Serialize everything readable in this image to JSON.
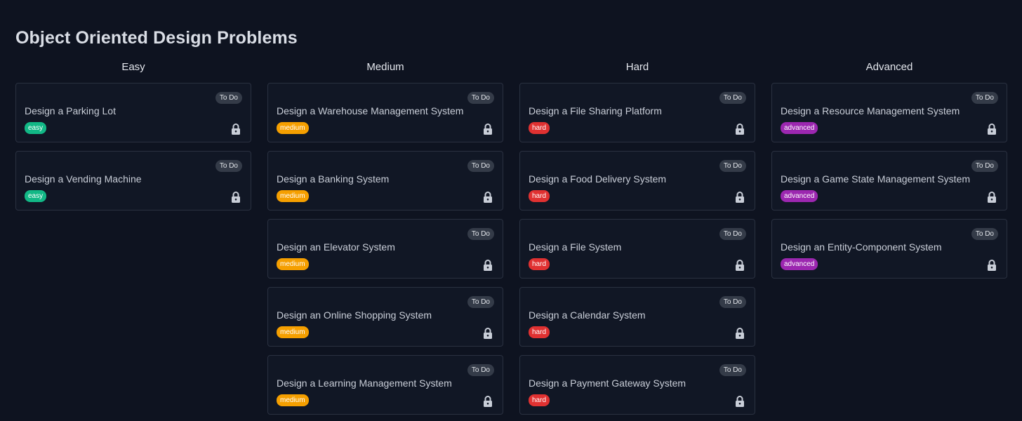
{
  "page": {
    "title": "Object Oriented Design Problems"
  },
  "columns": [
    {
      "title": "Easy",
      "level": "easy",
      "cards": [
        {
          "title": "Design a Parking Lot",
          "status": "To Do",
          "difficulty": "easy",
          "icon": "lock-icon"
        },
        {
          "title": "Design a Vending Machine",
          "status": "To Do",
          "difficulty": "easy",
          "icon": "lock-icon"
        }
      ]
    },
    {
      "title": "Medium",
      "level": "medium",
      "cards": [
        {
          "title": "Design a Warehouse Management System",
          "status": "To Do",
          "difficulty": "medium",
          "icon": "lock-icon"
        },
        {
          "title": "Design a Banking System",
          "status": "To Do",
          "difficulty": "medium",
          "icon": "lock-icon"
        },
        {
          "title": "Design an Elevator System",
          "status": "To Do",
          "difficulty": "medium",
          "icon": "lock-icon"
        },
        {
          "title": "Design an Online Shopping System",
          "status": "To Do",
          "difficulty": "medium",
          "icon": "lock-icon"
        },
        {
          "title": "Design a Learning Management System",
          "status": "To Do",
          "difficulty": "medium",
          "icon": "lock-icon"
        }
      ]
    },
    {
      "title": "Hard",
      "level": "hard",
      "cards": [
        {
          "title": "Design a File Sharing Platform",
          "status": "To Do",
          "difficulty": "hard",
          "icon": "lock-icon"
        },
        {
          "title": "Design a Food Delivery System",
          "status": "To Do",
          "difficulty": "hard",
          "icon": "lock-icon"
        },
        {
          "title": "Design a File System",
          "status": "To Do",
          "difficulty": "hard",
          "icon": "lock-icon"
        },
        {
          "title": "Design a Calendar System",
          "status": "To Do",
          "difficulty": "hard",
          "icon": "lock-icon"
        },
        {
          "title": "Design a Payment Gateway System",
          "status": "To Do",
          "difficulty": "hard",
          "icon": "lock-icon"
        }
      ]
    },
    {
      "title": "Advanced",
      "level": "advanced",
      "cards": [
        {
          "title": "Design a Resource Management System",
          "status": "To Do",
          "difficulty": "advanced",
          "icon": "lock-icon"
        },
        {
          "title": "Design a Game State Management System",
          "status": "To Do",
          "difficulty": "advanced",
          "icon": "lock-icon"
        },
        {
          "title": "Design an Entity-Component System",
          "status": "To Do",
          "difficulty": "advanced",
          "icon": "lock-icon"
        }
      ]
    }
  ],
  "colors": {
    "background": "#0e1320",
    "card_background": "#111725",
    "card_border": "#2a3140",
    "status_badge": "#343b48",
    "easy": "#12b886",
    "medium": "#f59f00",
    "hard": "#e03131",
    "advanced": "#9c27b0",
    "lock_icon": "#c9ced8"
  }
}
